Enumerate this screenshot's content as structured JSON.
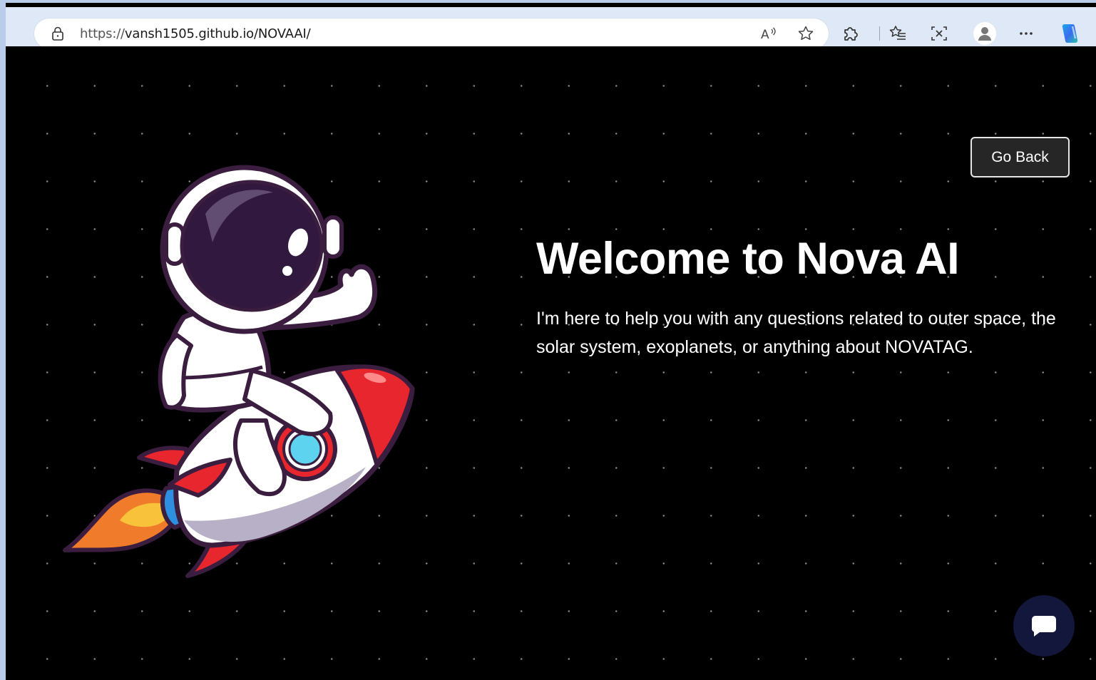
{
  "browser": {
    "url_protocol": "https://",
    "url_host_path": "vansh1505.github.io/NOVAAI/",
    "icons": [
      "lock-icon",
      "read-aloud-icon",
      "favorite-star-icon",
      "extensions-icon",
      "favorites-icon",
      "screenshot-icon",
      "profile-avatar-icon",
      "more-options-icon",
      "copilot-icon"
    ]
  },
  "page": {
    "title": "Welcome to Nova AI",
    "description": "I'm here to help you with any questions related to outer space, the solar system, exoplanets, or anything about NOVATAG.",
    "go_back_label": "Go Back",
    "chat_button_icon": "chat-bubble-icon",
    "hero_image": "astronaut-on-rocket-illustration"
  },
  "colors": {
    "background": "#000000",
    "chat_fab": "#13173b",
    "button_bg": "#262626"
  }
}
